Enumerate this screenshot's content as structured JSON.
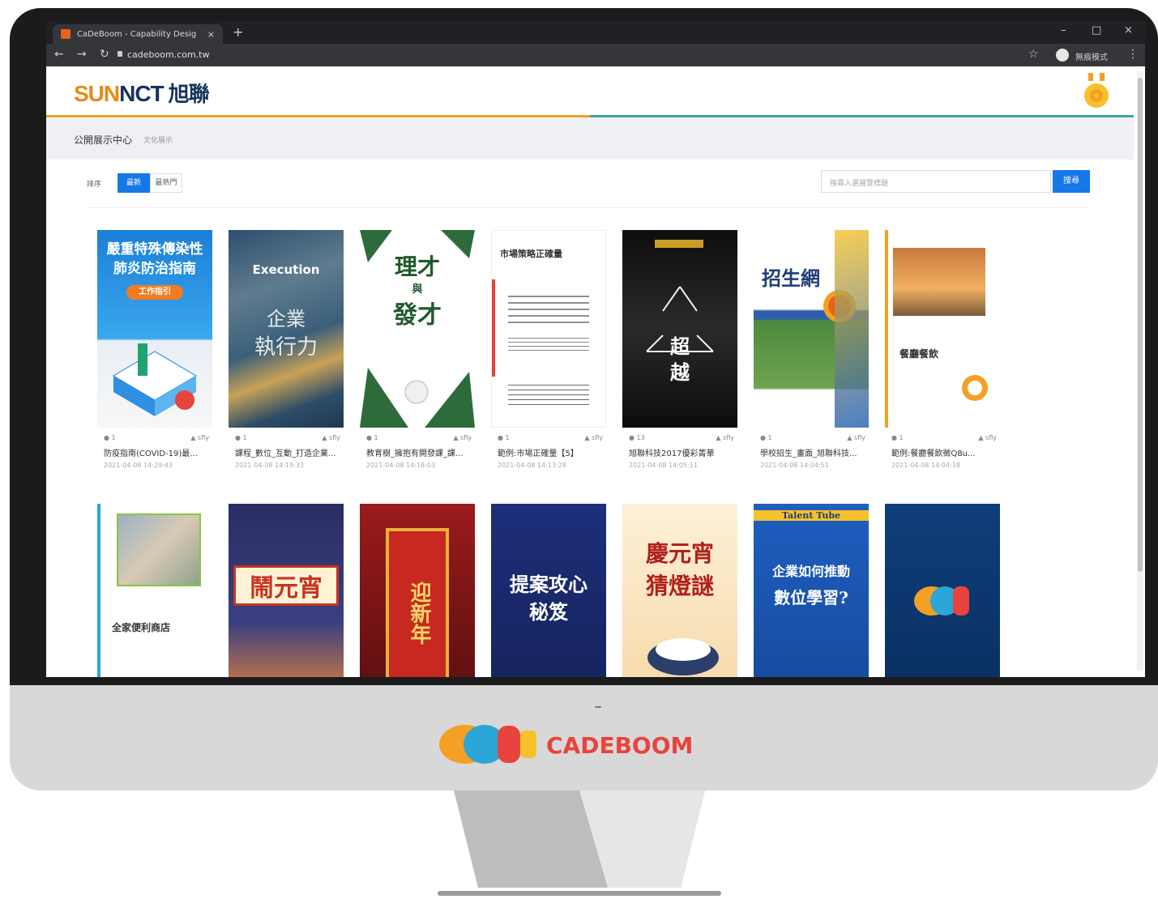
{
  "browser": {
    "tab_title": "CaDeBoom - Capability Desig",
    "tab_close": "×",
    "new_tab": "+",
    "url": "cadeboom.com.tw",
    "profile_name": "無痕模式",
    "minimize": "–",
    "maximize": "□",
    "close": "×",
    "back": "←",
    "forward": "→",
    "reload": "↻",
    "bookmark": "☆",
    "menu": "⋮"
  },
  "site": {
    "logo_text_a": "SUN",
    "logo_text_b": "NCT",
    "logo_text_cn": "旭聯",
    "breadcrumb_title": "公開展示中心",
    "breadcrumb_sub": "文化展示"
  },
  "filters": {
    "label": "排序",
    "active_option": "最新",
    "option_2": "最熱門"
  },
  "search": {
    "placeholder": "搜尋入選展覽標題",
    "button": "搜尋"
  },
  "cards_row1": [
    {
      "views": "1",
      "author": "sfly",
      "name": "防疫指南(COVID-19)最...",
      "date": "2021-04-08 14:29:43"
    },
    {
      "views": "1",
      "author": "sfly",
      "name": "課程_數位_互動_打造企業...",
      "date": "2021-04-08 14:19:33"
    },
    {
      "views": "1",
      "author": "sfly",
      "name": "教育樹_擁抱有開發課_課...",
      "date": "2021-04-08 14:18:03"
    },
    {
      "views": "1",
      "author": "sfly",
      "name": "範例:市場正確量【5】",
      "date": "2021-04-08 14:13:28"
    },
    {
      "views": "13",
      "author": "sfly",
      "name": "旭聯科技2017優彩菁華",
      "date": "2021-04-08 14:05:11"
    },
    {
      "views": "1",
      "author": "sfly",
      "name": "學校招生_畫面_旭聯科技...",
      "date": "2021-04-08 14:04:51"
    },
    {
      "views": "1",
      "author": "sfly",
      "name": "範例:餐廳餐飲徵Q8u...",
      "date": "2021-04-08 14:04:18"
    }
  ],
  "posters": {
    "p1_title": "嚴重特殊傳染性肺炎防治指南",
    "p1_badge": "工作指引",
    "p2_title": "Execution",
    "p2_line1": "企業",
    "p2_line2": "執行力",
    "p3_line1": "理才",
    "p3_line2": "與",
    "p3_line3": "發才",
    "p4_title": "市場策略正確量",
    "p5_line1": "超",
    "p5_line2": "越",
    "p6_title": "招生網",
    "p7_title": "餐廳餐飲",
    "p8_title": "全家便利商店",
    "p9_title": "鬧元宵",
    "p10_title": "迎新年",
    "p11_line1": "提案攻心",
    "p11_line2": "秘笈",
    "p12_line1": "慶元宵",
    "p12_line2": "猜燈謎",
    "p13_line1": "企業如何推動",
    "p13_line2": "數位學習?",
    "p13_banner": "Talent Tube"
  },
  "brand": {
    "wordmark": "CADEBOOM"
  }
}
